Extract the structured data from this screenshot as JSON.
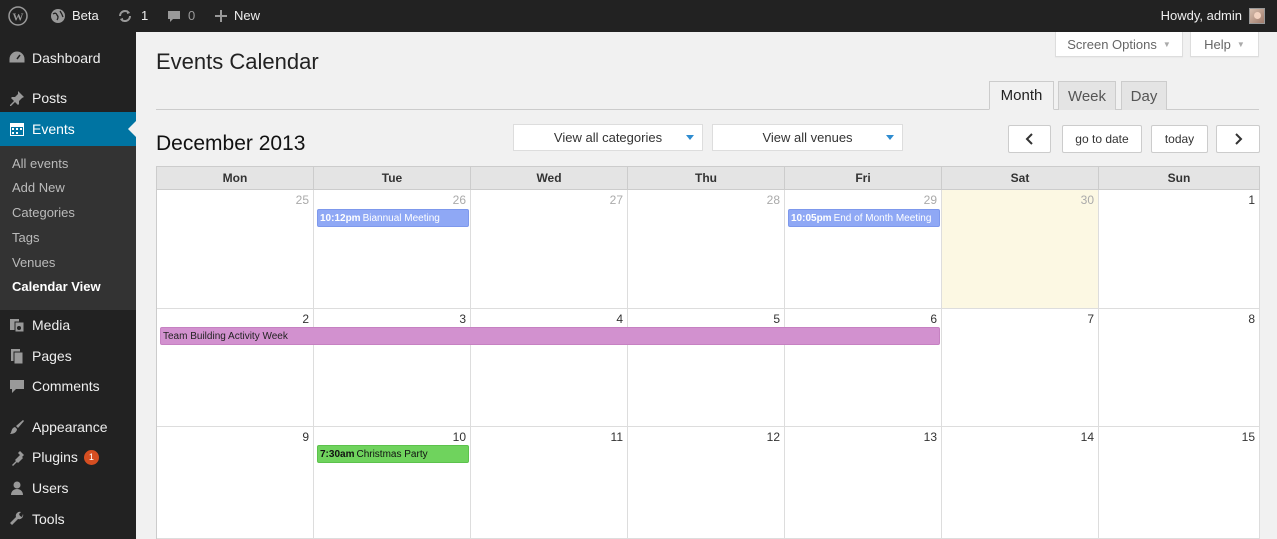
{
  "adminbar": {
    "site_name": "Beta",
    "updates_count": "1",
    "comments_count": "0",
    "new_label": "New",
    "howdy": "Howdy, admin"
  },
  "sidebar": {
    "items": [
      {
        "label": "Dashboard",
        "icon": "dashboard-icon"
      },
      {
        "label": "Posts",
        "icon": "pin-icon"
      },
      {
        "label": "Events",
        "icon": "calendar-icon"
      },
      {
        "label": "Media",
        "icon": "media-icon"
      },
      {
        "label": "Pages",
        "icon": "pages-icon"
      },
      {
        "label": "Comments",
        "icon": "comment-icon"
      },
      {
        "label": "Appearance",
        "icon": "brush-icon"
      },
      {
        "label": "Plugins",
        "icon": "plugin-icon",
        "badge": "1"
      },
      {
        "label": "Users",
        "icon": "user-icon"
      },
      {
        "label": "Tools",
        "icon": "wrench-icon"
      }
    ],
    "submenu": [
      "All events",
      "Add New",
      "Categories",
      "Tags",
      "Venues",
      "Calendar View"
    ]
  },
  "screen_options": "Screen Options",
  "help": "Help",
  "page_title": "Events Calendar",
  "view_tabs": [
    "Month",
    "Week",
    "Day"
  ],
  "month_title": "December 2013",
  "filters": {
    "categories": "View all categories",
    "venues": "View all venues"
  },
  "nav": {
    "go_to_date": "go to date",
    "today": "today"
  },
  "calendar": {
    "weekdays": [
      "Mon",
      "Tue",
      "Wed",
      "Thu",
      "Fri",
      "Sat",
      "Sun"
    ],
    "weeks": [
      [
        "25",
        "26",
        "27",
        "28",
        "29",
        "30",
        "1"
      ],
      [
        "2",
        "3",
        "4",
        "5",
        "6",
        "7",
        "8"
      ],
      [
        "9",
        "10",
        "11",
        "12",
        "13",
        "14",
        "15"
      ]
    ],
    "events": [
      {
        "time": "10:12pm",
        "title": "Biannual Meeting"
      },
      {
        "time": "10:05pm",
        "title": "End of Month Meeting"
      },
      {
        "time": "",
        "title": "Team Building Activity Week"
      },
      {
        "time": "7:30am",
        "title": "Christmas Party"
      }
    ]
  },
  "colors": {
    "accent": "#0074a2",
    "event_blue": "#8fa8f5",
    "event_purple": "#d291cf",
    "event_green": "#6fd35d",
    "today_bg": "#fcf8e3"
  }
}
